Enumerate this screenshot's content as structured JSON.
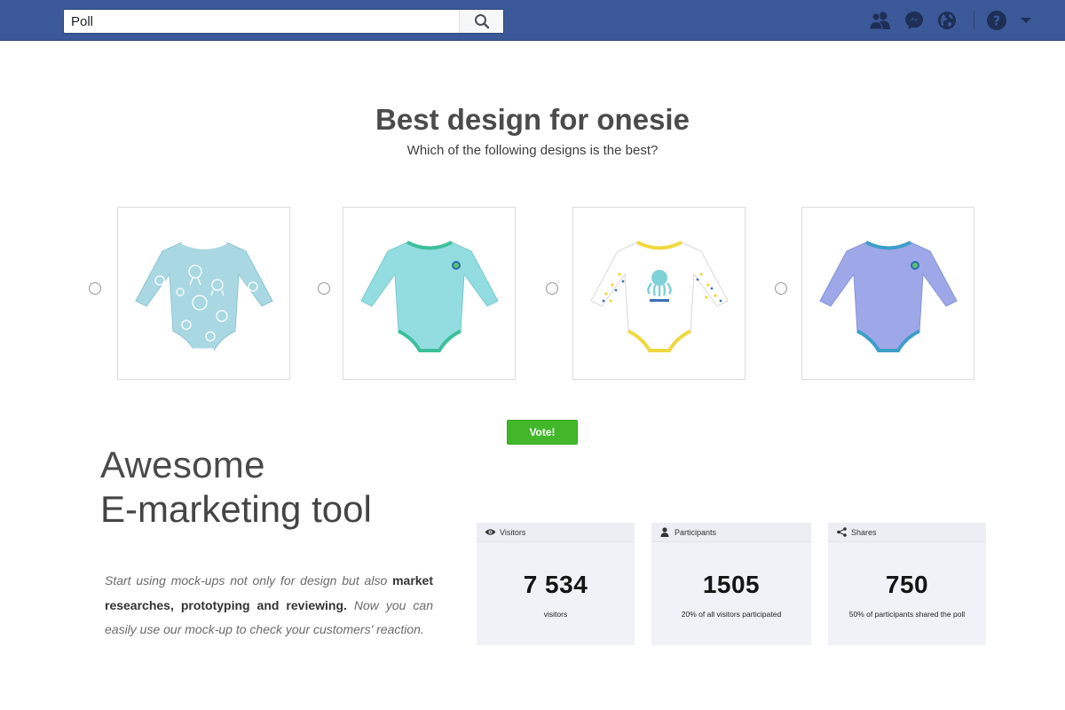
{
  "search": {
    "value": "Poll"
  },
  "nav_icons": [
    "friends-icon",
    "messenger-icon",
    "globe-icon",
    "help-icon",
    "caret-down-icon"
  ],
  "poll": {
    "title": "Best design for onesie",
    "question": "Which of the following designs is the best?",
    "options": [
      {
        "design": "light blue with sea animal print",
        "color": "#9fd3df"
      },
      {
        "design": "plain turquoise with patch",
        "color": "#8fd9de"
      },
      {
        "design": "white with octopus and dotted sleeves",
        "color": "#ffffff"
      },
      {
        "design": "plain lavender with patch",
        "color": "#9aa7e6"
      }
    ],
    "vote_label": "Vote!"
  },
  "marketing": {
    "line1": "Awesome",
    "line2": "E-marketing tool",
    "body_part1": "Start using mock-ups not only for design but also ",
    "body_bold": "market researches, prototyping and reviewing.",
    "body_part2": " Now you can easily use our mock-up to check your customers' reaction."
  },
  "stats": [
    {
      "label": "Visitors",
      "icon": "eye-icon",
      "value": "7 534",
      "caption": "visitors"
    },
    {
      "label": "Participants",
      "icon": "person-icon",
      "value": "1505",
      "caption": "20% of all visitors participated"
    },
    {
      "label": "Shares",
      "icon": "share-icon",
      "value": "750",
      "caption": "50% of participants shared the poll"
    }
  ],
  "colors": {
    "topbar": "#3b5998",
    "vote": "#42b72a",
    "stat_bg": "#f0f2f7"
  }
}
